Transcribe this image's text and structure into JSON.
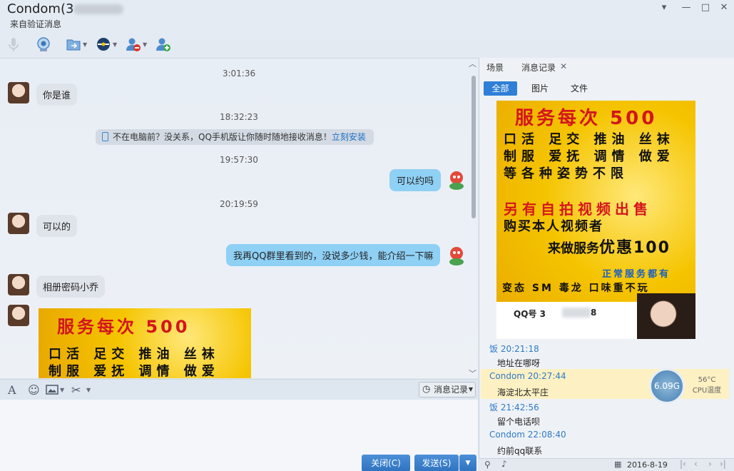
{
  "window": {
    "title": "Condom(3",
    "subtitle": "来自验证消息",
    "controls": [
      "▾",
      "—",
      "□",
      "✕"
    ]
  },
  "toolbar": {
    "icons": [
      "microphone-icon",
      "video-call-icon",
      "file-transfer-icon",
      "remote-assist-icon",
      "remove-contact-icon",
      "add-contact-icon"
    ]
  },
  "chat": {
    "messages": [
      {
        "time": "3:01:36"
      },
      {
        "from": "them",
        "text": "你是谁"
      },
      {
        "time": "18:32:23"
      },
      {
        "notice": "不在电脑前？没关系，QQ手机版让你随时随地接收消息！",
        "notice_link": "立刻安装"
      },
      {
        "time": "19:57:30"
      },
      {
        "from": "me",
        "text": "可以约吗"
      },
      {
        "time": "20:19:59"
      },
      {
        "from": "them",
        "text": "可以的"
      },
      {
        "from": "me",
        "text": "我再QQ群里看到的，没说多少钱，能介绍一下嘛"
      },
      {
        "from": "them",
        "text": "相册密码小乔"
      }
    ],
    "ad": {
      "title": "服务每次 500",
      "line1": "口活 足交 推油 丝袜",
      "line2": "制服 爱抚 调情 做爱"
    }
  },
  "input": {
    "history_button": "消息记录",
    "close_button": "关闭(C)",
    "send_button": "发送(S)"
  },
  "right_panel": {
    "tabs": [
      "场景",
      "消息记录"
    ],
    "subtabs": [
      "全部",
      "图片",
      "文件"
    ],
    "ad": {
      "title": "服务每次 500",
      "line1": "口活 足交 推油 丝袜",
      "line2": "制服 爱抚 调情 做爱",
      "line3": "等各种姿势不限",
      "line4": "另有自拍视频出售",
      "line5": "购买本人视频者",
      "line6a": "来做服务",
      "line6b": "优惠100",
      "line7": "正常服务都有",
      "line8": "变态 SM 毒龙 口味重不玩",
      "qq": "QQ号 3",
      "qq_end": "8"
    },
    "log": [
      {
        "name": "饭 20:21:18",
        "text": "地址在哪呀"
      },
      {
        "name": "Condom 20:27:44",
        "text": "海淀北太平庄"
      },
      {
        "name": "饭 21:42:56",
        "text": "留个电话呗"
      },
      {
        "name": "Condom 22:08:40",
        "text": "约前qq联系"
      }
    ],
    "gauge": {
      "value": "6.09G",
      "temp": "56°C",
      "label": "CPU温度"
    },
    "date": "2016-8-19"
  }
}
